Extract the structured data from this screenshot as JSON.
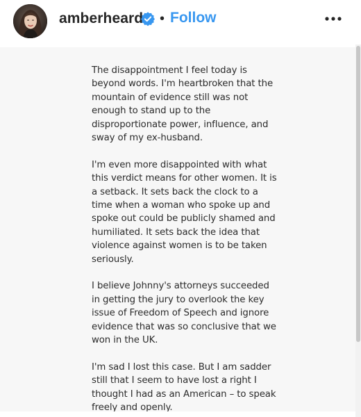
{
  "header": {
    "username": "amberheard",
    "separator": "•",
    "follow_label": "Follow",
    "verified_icon": "verified-badge-icon",
    "more_icon": "more-options-icon",
    "accent_color": "#3897f0"
  },
  "post": {
    "paragraphs": [
      "The disappointment I feel today is beyond words. I'm heartbroken that the mountain of evidence still was not enough to stand up to the disproportionate power, influence, and sway of my ex-husband.",
      "I'm even more disappointed with what this verdict means for other women. It is a setback. It sets back the clock to a time when a woman who spoke up and spoke out could be publicly shamed and humiliated. It sets back the idea that violence against women is to be taken seriously.",
      "I believe Johnny's attorneys succeeded in getting the jury to overlook the key issue of Freedom of Speech and ignore evidence that was so conclusive that we won in the UK.",
      "I'm sad I lost this case. But I am sadder still that I seem to have lost a right I thought I had as an American – to speak freely and openly."
    ]
  }
}
